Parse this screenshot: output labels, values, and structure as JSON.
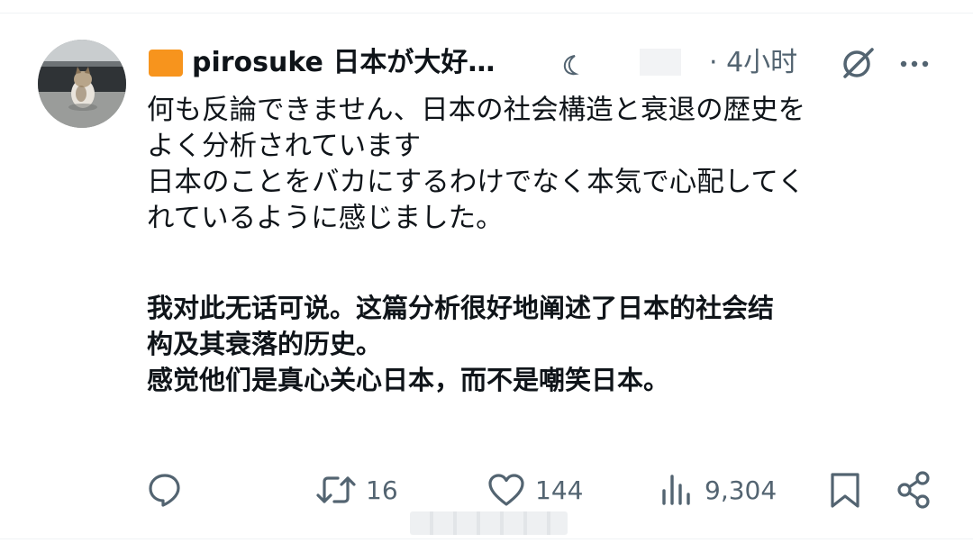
{
  "post": {
    "author": {
      "display_name": "pirosuke 日本が大好…",
      "flag_color": "#f7941d"
    },
    "timestamp": "· 4小时",
    "original_lines": [
      "何も反論できません、日本の社会構造と衰退の歴史を",
      "よく分析されています",
      "日本のことをバカにするわけでなく本気で心配してく",
      "れているように感じました。"
    ],
    "translation_lines": [
      "我对此无话可说。这篇分析很好地阐述了日本的社会结",
      "构及其衰落的历史。",
      "感觉他们是真心关心日本，而不是嘲笑日本。"
    ],
    "actions": {
      "reply_icon": "reply-icon",
      "retweet_count": "16",
      "like_count": "144",
      "view_count": "9,304"
    }
  },
  "colors": {
    "text_primary": "#0f1419",
    "text_secondary": "#536471",
    "divider": "#eff3f4"
  }
}
